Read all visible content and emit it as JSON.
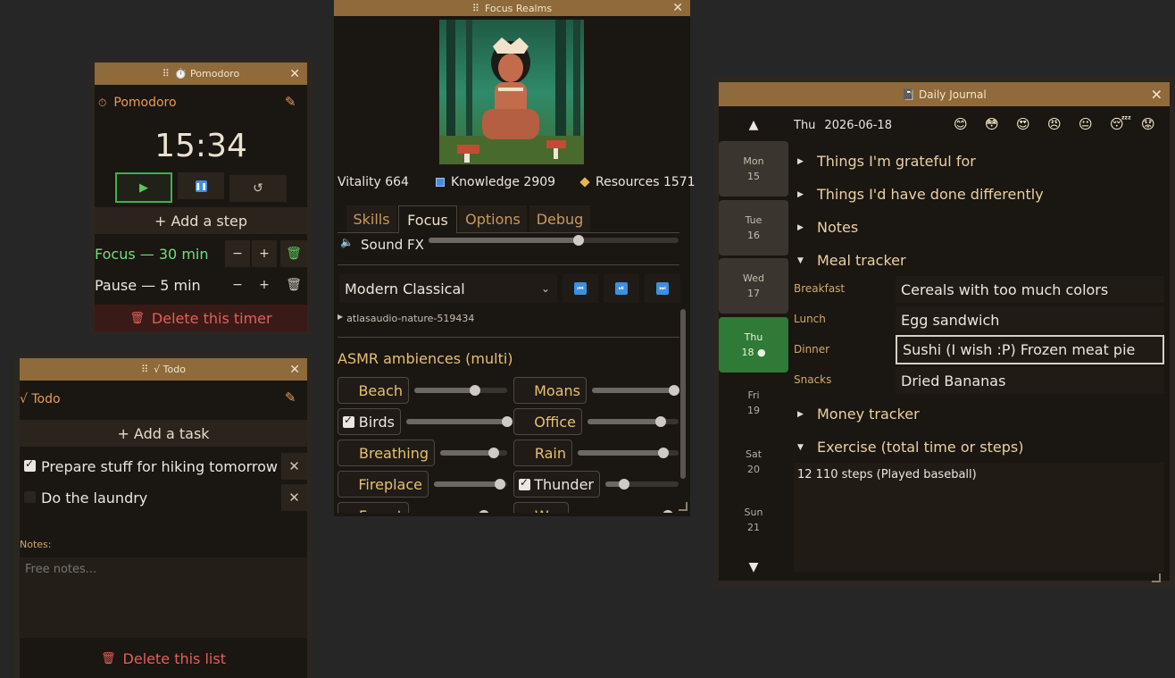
{
  "pomodoro": {
    "window_title": "⏱️ Pomodoro",
    "header": "Pomodoro",
    "time": "15:34",
    "add_step": "+ Add a step",
    "steps": [
      {
        "label": "Focus — 30 min",
        "minus": "−",
        "plus": "+"
      },
      {
        "label": "Pause — 5 min",
        "minus": "−",
        "plus": "+"
      }
    ],
    "delete": "Delete this timer"
  },
  "todo": {
    "window_title": "√ Todo",
    "header": "√ Todo",
    "add_task": "+ Add a task",
    "tasks": [
      {
        "label": "Prepare stuff for hiking tomorrow",
        "checked": true
      },
      {
        "label": "Do the laundry",
        "checked": false
      }
    ],
    "notes_label": "Notes:",
    "notes_placeholder": "Free notes...",
    "delete": "Delete this list"
  },
  "focus_realms": {
    "window_title": "Focus Realms",
    "stats": {
      "vitality": "Vitality 664",
      "knowledge": "Knowledge 2909",
      "resources": "Resources 1571"
    },
    "tabs": [
      "Skills",
      "Focus",
      "Options",
      "Debug"
    ],
    "active_tab": "Focus",
    "sound_fx_label": "Sound FX",
    "sound_fx_level": 0.6,
    "music_select": "Modern Classical",
    "track": "atlasaudio-nature-519434",
    "asmr_title": "ASMR ambiences (multi)",
    "ambiences": [
      {
        "label": "Beach",
        "checked": false,
        "level": 0.65
      },
      {
        "label": "Moans",
        "checked": false,
        "level": 0.95
      },
      {
        "label": "Birds",
        "checked": true,
        "level": 1.0
      },
      {
        "label": "Office",
        "checked": false,
        "level": 0.8
      },
      {
        "label": "Breathing",
        "checked": false,
        "level": 0.8
      },
      {
        "label": "Rain",
        "checked": false,
        "level": 0.85
      },
      {
        "label": "Fireplace",
        "checked": false,
        "level": 0.9
      },
      {
        "label": "Thunder",
        "checked": true,
        "level": 0.25
      },
      {
        "label": "Forest",
        "checked": false,
        "level": 0.75
      },
      {
        "label": "War",
        "checked": false,
        "level": 0.9
      }
    ]
  },
  "journal": {
    "window_title": "📓 Daily Journal",
    "date_day": "Thu",
    "date": "2026-06-18",
    "moods": [
      "😊",
      "😳",
      "😍",
      "😠",
      "😐",
      "😴",
      "😟"
    ],
    "days": [
      {
        "name": "Mon",
        "num": "15"
      },
      {
        "name": "Tue",
        "num": "16"
      },
      {
        "name": "Wed",
        "num": "17"
      },
      {
        "name": "Thu",
        "num": "18 ●"
      },
      {
        "name": "Fri",
        "num": "19"
      },
      {
        "name": "Sat",
        "num": "20"
      },
      {
        "name": "Sun",
        "num": "21"
      }
    ],
    "sections": {
      "grateful": "Things I'm grateful for",
      "differently": "Things I'd have done differently",
      "notes": "Notes",
      "meal": "Meal tracker",
      "money": "Money tracker",
      "exercise": "Exercise (total time or steps)"
    },
    "meals": [
      {
        "label": "Breakfast",
        "value": "Cereals with too much colors"
      },
      {
        "label": "Lunch",
        "value": "Egg sandwich"
      },
      {
        "label": "Dinner",
        "value": "Sushi (I wish :P) Frozen meat pie"
      },
      {
        "label": "Snacks",
        "value": "Dried Bananas"
      }
    ],
    "exercise_text": "12 110 steps (Played baseball)"
  },
  "colors": {
    "titlebar": "#8f6a3a",
    "accent_orange": "#e89a5a",
    "accent_green": "#58c95a",
    "delete_red": "#e0605a"
  }
}
